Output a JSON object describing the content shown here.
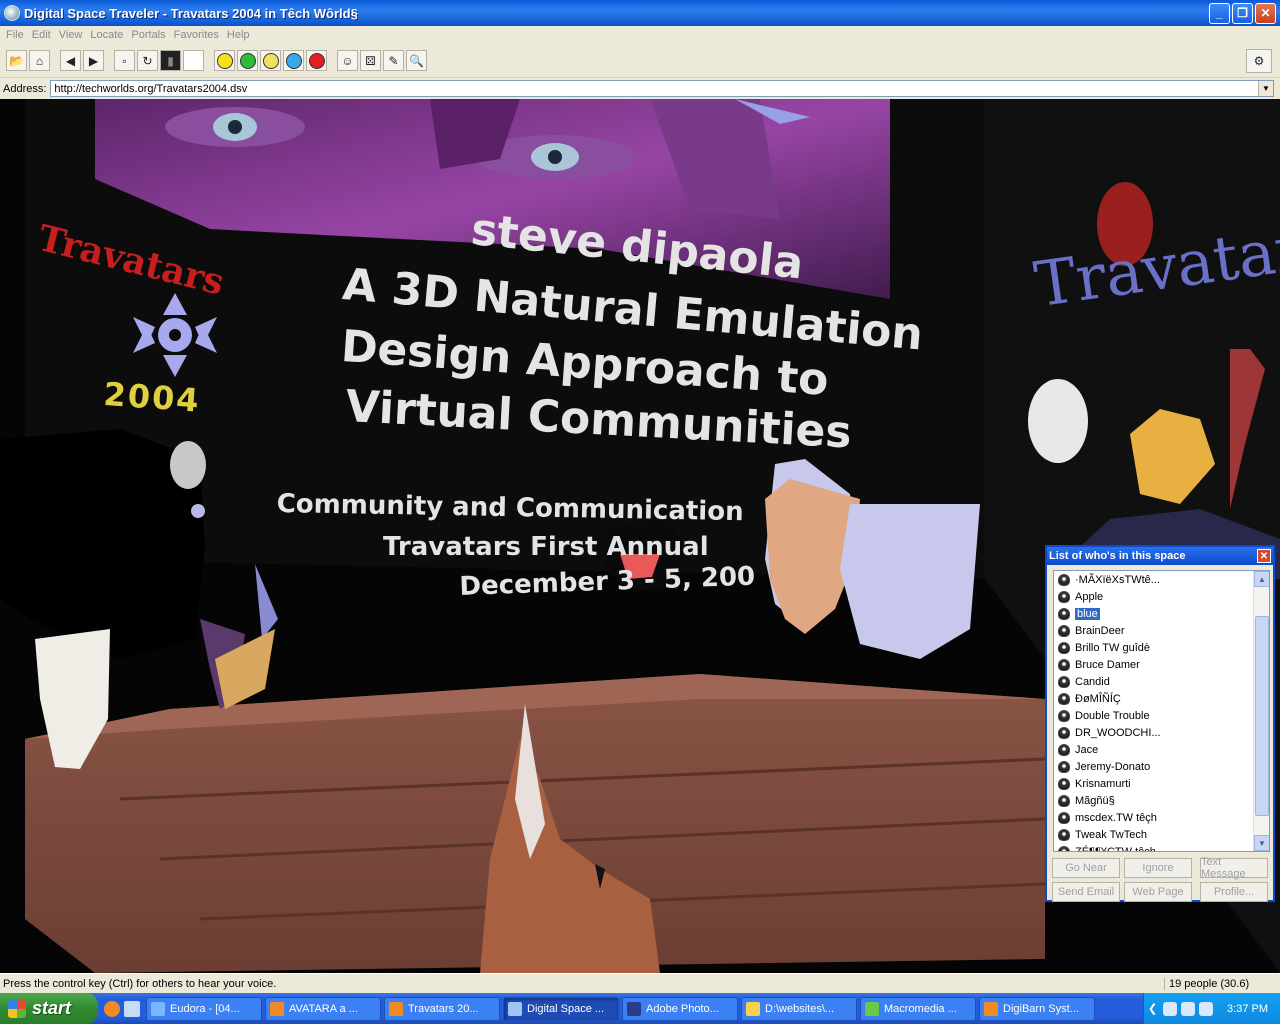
{
  "window": {
    "title": "Digital Space Traveler - Travatars 2004 in Têch Wôrld§"
  },
  "menu": [
    "File",
    "Edit",
    "View",
    "Locate",
    "Portals",
    "Favorites",
    "Help"
  ],
  "toolbar": {
    "icons": [
      "open-folder-icon",
      "home-icon",
      "back-icon",
      "forward-icon",
      "document-icon",
      "refresh-icon",
      "volume-icon",
      "white-swatch",
      "happy-face-icon",
      "green-face-icon",
      "neutral-face-icon",
      "sad-face-icon",
      "red-face-icon",
      "avatar-icon",
      "dice-icon",
      "document-edit-icon",
      "search-icon"
    ],
    "smiley_colors": [
      "#f5e21c",
      "#2ebd35",
      "#f0e060",
      "#3aa8e8",
      "#e02020"
    ]
  },
  "address": {
    "label": "Address:",
    "value": "http://techworlds.org/Travatars2004.dsv"
  },
  "scene": {
    "slide_lines": {
      "speaker": "steve dipaola",
      "title1": "A 3D Natural Emulation",
      "title2": "Design Approach to",
      "title3": "Virtual Communities",
      "sub1": "Community and Communication",
      "sub2": "Travatars First Annual",
      "sub3": "December 3 - 5, 200"
    },
    "logo_text": "Travatars",
    "logo_year": "2004",
    "wall_text": "Travatar"
  },
  "people_panel": {
    "title": "List of who's in this space",
    "people": [
      "·MÃXïëXsTWtê...",
      "Apple",
      "blue",
      "BrainDeer",
      "Brillo TW guîdè",
      "Bruce Damer",
      "Candid",
      "ÐøMÎÑÍÇ",
      "Double Trouble",
      "DR_WOODCHI...",
      "Jace",
      "Jeremy-Donato",
      "Krisnamurti",
      "Mãgñü§",
      "mscdex.TW têçh",
      "Tweak TwTech",
      "ZÉ¶¶¥ÇTW têçh"
    ],
    "selected": "blue",
    "buttons": {
      "go_near": "Go Near",
      "ignore": "Ignore",
      "text_message": "Text Message",
      "send_email": "Send Email",
      "web_page": "Web Page",
      "profile": "Profile..."
    }
  },
  "status": {
    "message": "Press the control key (Ctrl) for others to hear your voice.",
    "count": "19 people (30.6)"
  },
  "taskbar": {
    "start": "start",
    "tasks": [
      {
        "label": "Eudora - [04...",
        "color": "#7db6ff"
      },
      {
        "label": "AVATARA a ...",
        "color": "#f08a24"
      },
      {
        "label": "Travatars 20...",
        "color": "#f08a24"
      },
      {
        "label": "Digital Space ...",
        "color": "#9ec4f8"
      },
      {
        "label": "Adobe Photo...",
        "color": "#2b3b8c"
      },
      {
        "label": "D:\\websites\\...",
        "color": "#f5d24a"
      },
      {
        "label": "Macromedia ...",
        "color": "#6ac84b"
      },
      {
        "label": "DigiBarn Syst...",
        "color": "#f08a24"
      }
    ],
    "clock": "3:37 PM"
  }
}
